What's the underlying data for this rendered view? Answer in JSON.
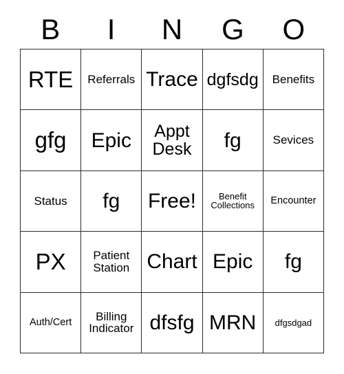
{
  "card": {
    "title": "BINGO",
    "header_letters": [
      "B",
      "I",
      "N",
      "G",
      "O"
    ],
    "colors": {
      "border": "#2b2b2b",
      "text": "#000000",
      "background": "#ffffff"
    },
    "grid": {
      "rows": 5,
      "columns": 5,
      "free_space_label": "Free!",
      "free_space_position": {
        "row": 3,
        "column": 3
      }
    },
    "cells": [
      [
        {
          "label": "RTE",
          "size": "xl"
        },
        {
          "label": "Referrals",
          "size": "sm"
        },
        {
          "label": "Trace",
          "size": "lg"
        },
        {
          "label": "dgfsdg",
          "size": "md"
        },
        {
          "label": "Benefits",
          "size": "sm"
        }
      ],
      [
        {
          "label": "gfg",
          "size": "xl"
        },
        {
          "label": "Epic",
          "size": "lg"
        },
        {
          "label": "Appt Desk",
          "size": "md"
        },
        {
          "label": "fg",
          "size": "lg"
        },
        {
          "label": "Sevices",
          "size": "sm"
        }
      ],
      [
        {
          "label": "Status",
          "size": "sm"
        },
        {
          "label": "fg",
          "size": "lg"
        },
        {
          "label": "Free!",
          "size": "lg"
        },
        {
          "label": "Benefit Collections",
          "size": "xxs"
        },
        {
          "label": "Encounter",
          "size": "xs"
        }
      ],
      [
        {
          "label": "PX",
          "size": "xl"
        },
        {
          "label": "Patient Station",
          "size": "sm"
        },
        {
          "label": "Chart",
          "size": "lg"
        },
        {
          "label": "Epic",
          "size": "lg"
        },
        {
          "label": "fg",
          "size": "lg"
        }
      ],
      [
        {
          "label": "Auth/Cert",
          "size": "xs"
        },
        {
          "label": "Billing Indicator",
          "size": "sm"
        },
        {
          "label": "dfsfg",
          "size": "lg"
        },
        {
          "label": "MRN",
          "size": "lg"
        },
        {
          "label": "dfgsdgad",
          "size": "xxs"
        }
      ]
    ]
  }
}
